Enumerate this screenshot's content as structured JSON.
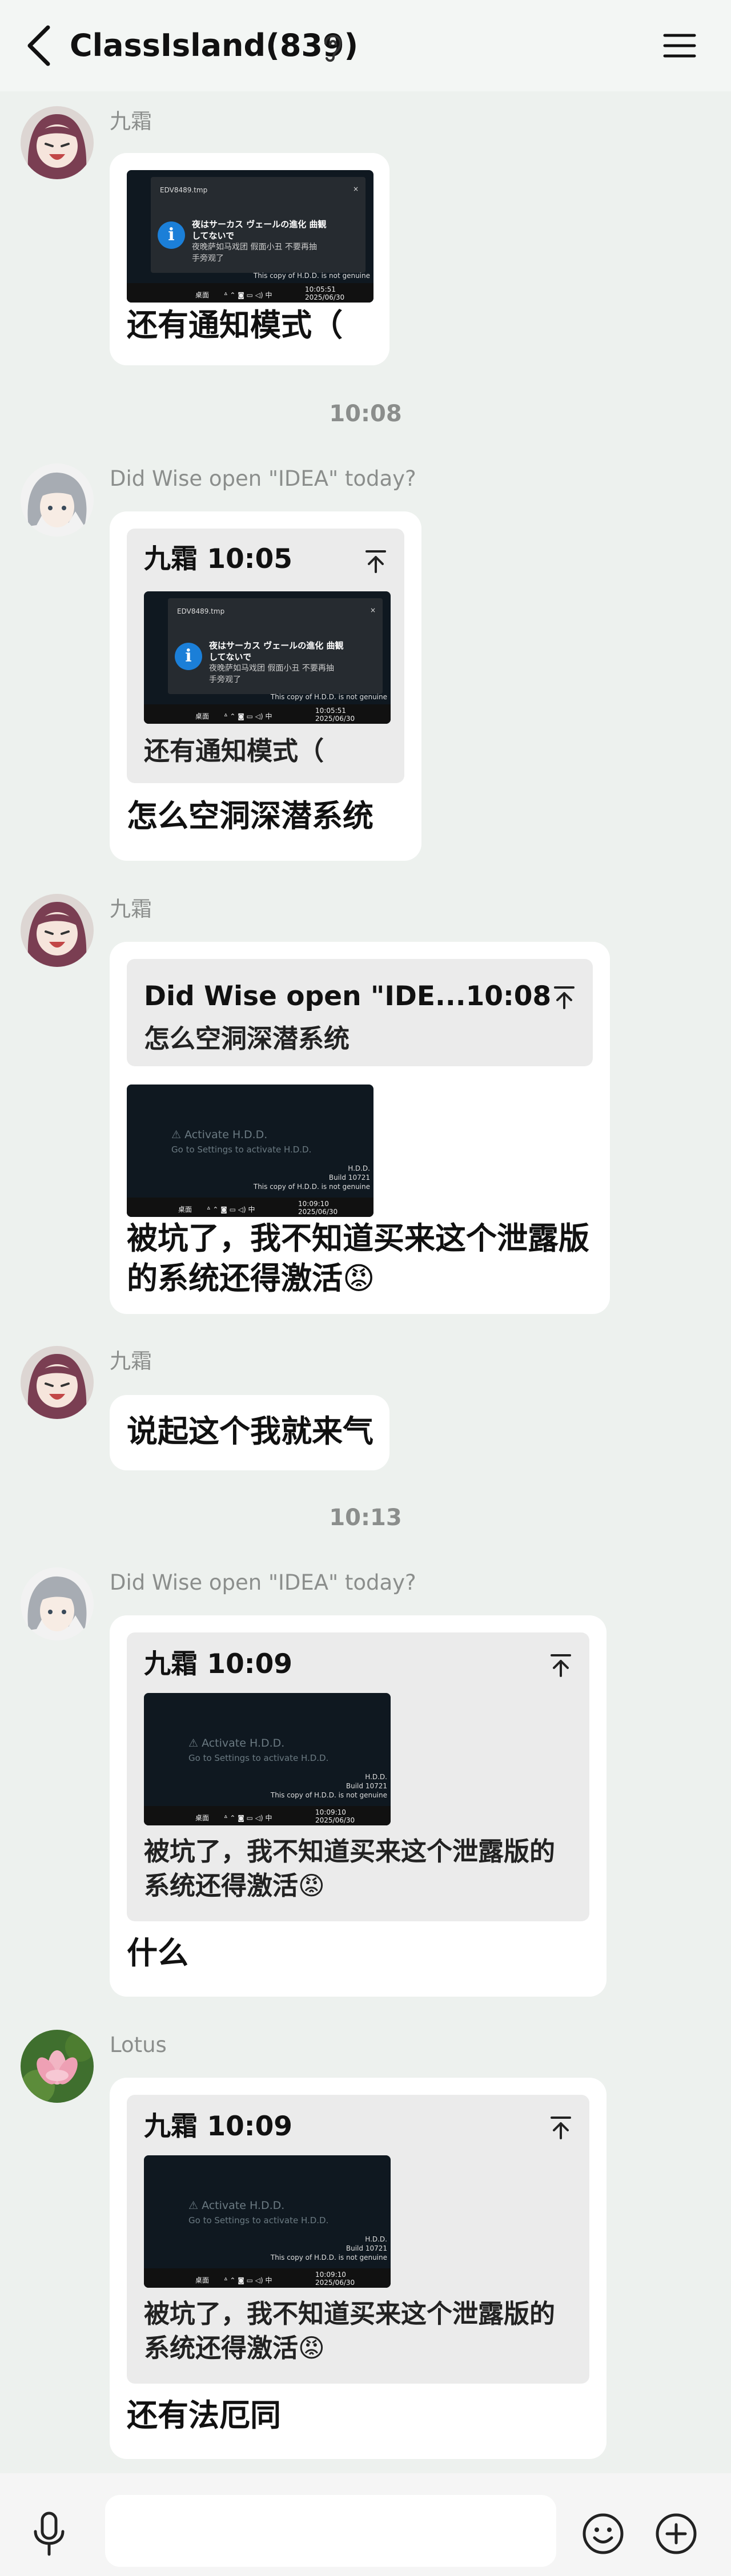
{
  "header": {
    "title": "ClassIsland(839)"
  },
  "people": {
    "jiushuang": "九霜",
    "wise": "Did Wise open \"IDEA\" today?",
    "lotus": "Lotus"
  },
  "times": {
    "t1": "10:08",
    "t2": "10:13"
  },
  "shot_common": {
    "taskbar_left": "桌面",
    "taskbar_icons": "ᐞ ⌃ ◙ ▭ ◁) 中",
    "wm1": "This copy of H.D.D. is not genuine",
    "activate_title": "⚠ Activate H.D.D.",
    "activate_sub": "Go to Settings to activate H.D.D.",
    "hdd": "H.D.D.",
    "build": "Build 10721",
    "notif_icon": "i"
  },
  "toast": {
    "file": "EDV8489.tmp",
    "head1": "夜はサーカス ヴェールの進化 曲観",
    "head2": "してないで",
    "body1": "夜晚萨如马戏团 假面小丑 不要再抽",
    "body2": "手旁观了",
    "close": "×"
  },
  "messages": {
    "m1": {
      "shot_time": "10:05:51",
      "shot_date": "2025/06/30",
      "text": "还有通知模式（"
    },
    "m2": {
      "quote_head": "九霜 10:05",
      "quote_text": "还有通知模式（",
      "shot_time": "10:05:51",
      "shot_date": "2025/06/30",
      "text": "怎么空洞深潜系统"
    },
    "m3": {
      "quote_head": "Did Wise open \"IDE...10:08",
      "quote_text": "怎么空洞深潜系统",
      "shot_time": "10:09:10",
      "shot_date": "2025/06/30",
      "text_line1": "被坑了，我不知道买来这个泄露版",
      "text_line2": "的系统还得激活😡"
    },
    "m4": {
      "text": "说起这个我就来气"
    },
    "m5": {
      "quote_head": "九霜 10:09",
      "quote_line1": "被坑了，我不知道买来这个泄露版的",
      "quote_line2": "系统还得激活😡",
      "shot_time": "10:09:10",
      "shot_date": "2025/06/30",
      "text": "什么"
    },
    "m6": {
      "quote_head": "九霜 10:09",
      "quote_line1": "被坑了，我不知道买来这个泄露版的",
      "quote_line2": "系统还得激活😡",
      "shot_time": "10:09:10",
      "shot_date": "2025/06/30",
      "text": "还有法厄同"
    }
  },
  "icons": {
    "back": "chevron-left-icon",
    "ear": "ear-icon",
    "menu": "hamburger-menu-icon",
    "pin": "pin-to-top-icon",
    "mic": "microphone-icon",
    "emoji": "smiley-icon",
    "plus": "plus-circle-icon"
  },
  "colors": {
    "background": "#edf1ee",
    "bubble": "#ffffff",
    "quote": "#ebebeb",
    "meta_text": "#8b8e8c"
  }
}
